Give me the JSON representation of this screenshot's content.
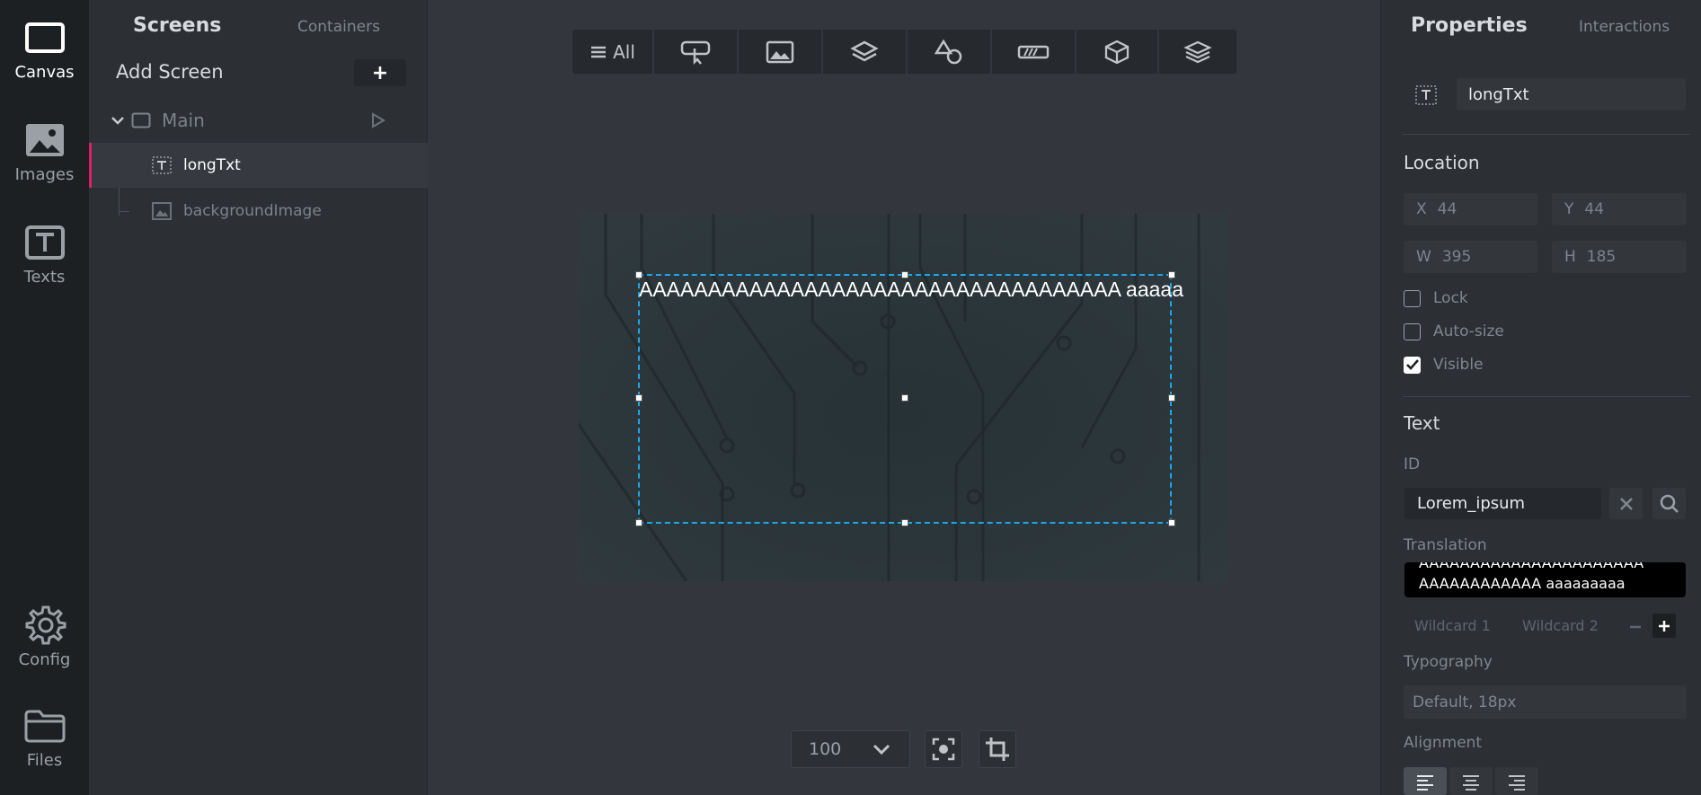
{
  "rail": {
    "canvas": "Canvas",
    "images": "Images",
    "texts": "Texts",
    "config": "Config",
    "files": "Files"
  },
  "screens_panel": {
    "tab_screens": "Screens",
    "tab_containers": "Containers",
    "add_screen": "Add Screen",
    "add_icon": "+",
    "tree": {
      "main": "Main",
      "items": [
        "longTxt",
        "backgroundImage"
      ]
    }
  },
  "toolbar": {
    "all_label": "All"
  },
  "canvas": {
    "text": "AAAAAAAAAAAAAAAAAAAAAAAAAAAAAAAAAAA aaaaa",
    "zoom": "100"
  },
  "properties": {
    "tab_properties": "Properties",
    "tab_interactions": "Interactions",
    "name_value": "longTxt",
    "location_title": "Location",
    "x_key": "X",
    "x_val": "44",
    "y_key": "Y",
    "y_val": "44",
    "w_key": "W",
    "w_val": "395",
    "h_key": "H",
    "h_val": "185",
    "lock": "Lock",
    "autosize": "Auto-size",
    "visible": "Visible",
    "text_title": "Text",
    "id_label": "ID",
    "id_value": "Lorem_ipsum",
    "translation_label": "Translation",
    "translation_line1": "AAAAAAAAAAAAAAAAAAAAAA",
    "translation_line2": "AAAAAAAAAAAA aaaaaaaaa",
    "wildcard1": "Wildcard 1",
    "wildcard2": "Wildcard 2",
    "typography_label": "Typography",
    "typography_value": "Default, 18px",
    "alignment_label": "Alignment"
  },
  "colors": {
    "selection": "#1ea6e8",
    "active_marker": "#e01e6e",
    "rail_bg": "#1d2023",
    "panel_bg": "#2c3035"
  }
}
